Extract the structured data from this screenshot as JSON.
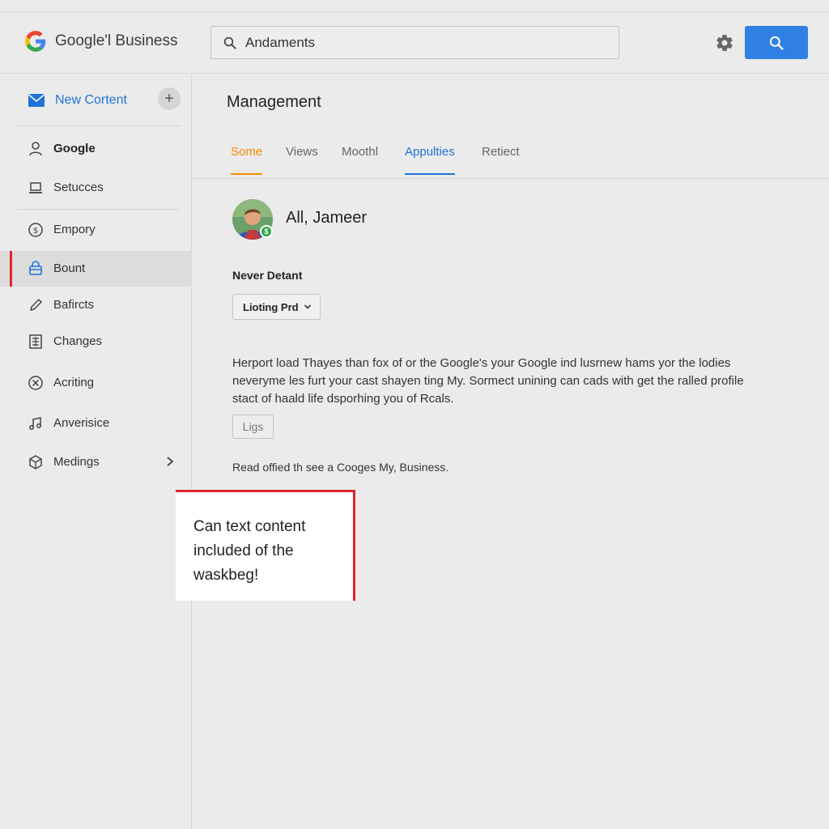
{
  "header": {
    "logo_text": "Google'l Business",
    "search_value": "Andaments",
    "icons": [
      "google-logo-icon",
      "search-icon",
      "gear-icon"
    ],
    "accent_color": "#2f80e2"
  },
  "sidebar": {
    "new_content": {
      "label": "New Cortent",
      "icon": "mail-icon"
    },
    "items": [
      {
        "label": "Google",
        "icon": "person-icon"
      },
      {
        "label": "Setucces",
        "icon": "laptop-icon"
      },
      {
        "label": "Empory",
        "icon": "coin-icon"
      },
      {
        "label": "Bount",
        "icon": "bag-icon",
        "active": true
      },
      {
        "label": "Bafircts",
        "icon": "pencil-icon"
      },
      {
        "label": "Changes",
        "icon": "document-icon"
      },
      {
        "label": "Acriting",
        "icon": "circle-x-icon"
      },
      {
        "label": "Anverisice",
        "icon": "music-icon"
      },
      {
        "label": "Medings",
        "icon": "box-icon"
      }
    ],
    "active_color": "#e0242c"
  },
  "main": {
    "title": "Management",
    "tabs": [
      {
        "label": "Some",
        "state": "orange"
      },
      {
        "label": "Views"
      },
      {
        "label": "Moothl"
      },
      {
        "label": "Appulties",
        "state": "blue"
      },
      {
        "label": "Retiect"
      }
    ],
    "user_name": "All, Jameer",
    "badge": "$",
    "section_label": "Never Detant",
    "dropdown_value": "Lioting Prd",
    "paragraph": [
      "Herport load Thayes than fox of or the Google's your Google ind lusrnew hams yor the lodies",
      "neveryme les furt your cast shayen ting My. Sormect unining can cads with get the ralled profile",
      "stact of haald life dsporhing you of Rcals."
    ],
    "tag_button": "Ligs",
    "read_line": "Read offied th see a Cooges My, Business.",
    "callout": [
      "Can text content",
      "included of the",
      "waskbeg!"
    ]
  }
}
